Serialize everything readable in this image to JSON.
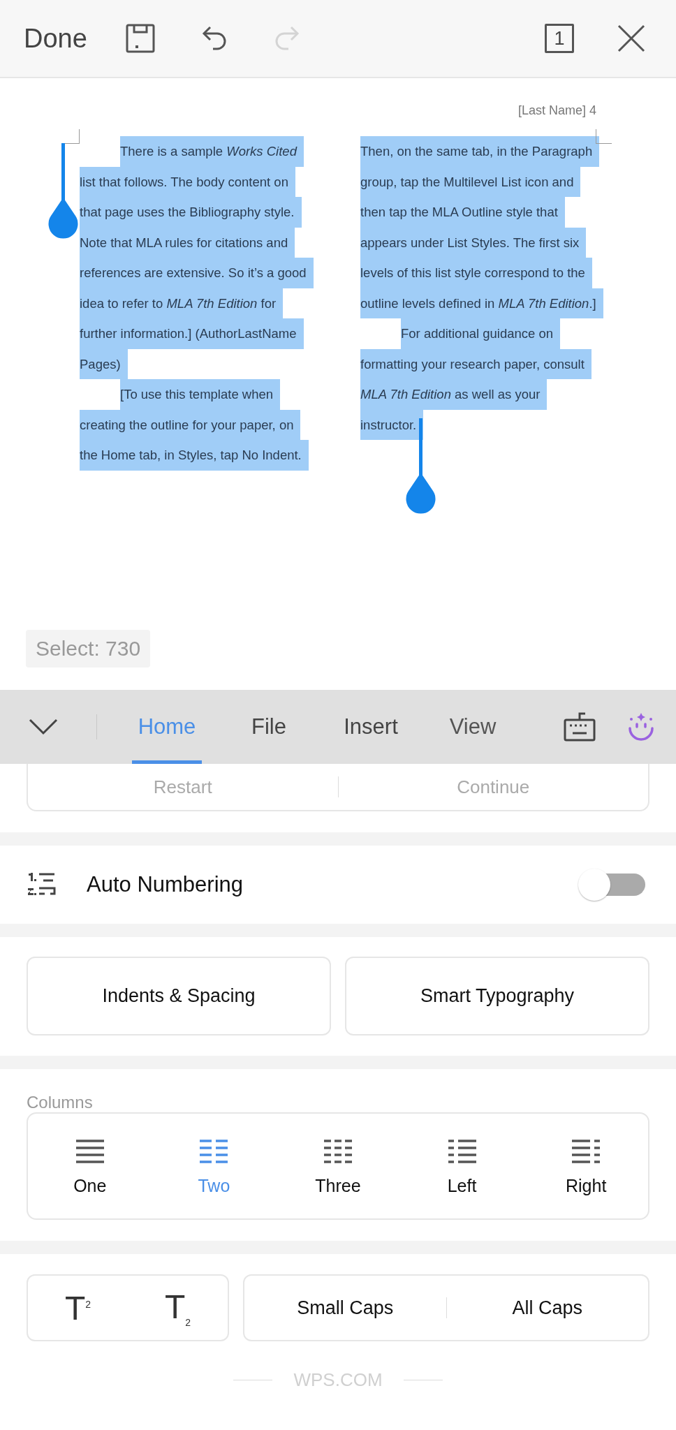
{
  "top_bar": {
    "done": "Done",
    "undo": {
      "disabled": false
    },
    "redo": {
      "disabled": true
    },
    "page_count": "1"
  },
  "document": {
    "header": "[Last Name] 4",
    "selected": true,
    "columns": [
      {
        "paragraphs": [
          {
            "indent": true,
            "lines": [
              "There is a sample *Works Cited*",
              "list that follows. The body content on",
              "that page uses the Bibliography style.",
              "Note that MLA rules for citations and",
              "references are extensive. So it’s a good",
              "idea to refer to *MLA 7th Edition* for",
              "further information.] (AuthorLastName",
              "Pages)"
            ]
          },
          {
            "indent": true,
            "lines": [
              "[To use this template when",
              "creating the outline for your paper, on",
              "the Home tab, in Styles, tap No Indent."
            ]
          }
        ]
      },
      {
        "paragraphs": [
          {
            "indent": false,
            "lines": [
              "Then, on the same tab, in the Paragraph",
              "group, tap the Multilevel List icon and",
              "then tap the MLA Outline style that",
              "appears under List Styles. The first six",
              "levels of this list style correspond to the",
              "outline levels defined in *MLA 7th Edition*.]"
            ]
          },
          {
            "indent": true,
            "lines": [
              "For additional guidance on",
              "formatting your research paper, consult",
              "*MLA 7th Edition* as well as your",
              "instructor."
            ]
          }
        ]
      }
    ]
  },
  "select_count": "Select: 730",
  "toolbar": {
    "tabs": [
      {
        "label": "Home",
        "selected": true
      },
      {
        "label": "File",
        "selected": false
      },
      {
        "label": "Insert",
        "selected": false
      },
      {
        "label": "View",
        "selected": false
      }
    ]
  },
  "numbering_buttons": [
    {
      "label": "Restart",
      "disabled": true
    },
    {
      "label": "Continue",
      "disabled": true
    }
  ],
  "auto_numbering": {
    "label": "Auto Numbering",
    "on": false
  },
  "paragraph_buttons": [
    "Indents & Spacing",
    "Smart Typography"
  ],
  "columns": {
    "label": "Columns",
    "options": [
      {
        "label": "One",
        "kind": "one",
        "selected": false
      },
      {
        "label": "Two",
        "kind": "two",
        "selected": true
      },
      {
        "label": "Three",
        "kind": "three",
        "selected": false
      },
      {
        "label": "Left",
        "kind": "left",
        "selected": false
      },
      {
        "label": "Right",
        "kind": "right",
        "selected": false
      }
    ]
  },
  "script_buttons": [
    "T$^{2}$",
    "T$_{2}$"
  ],
  "caps_buttons": [
    "Small Caps",
    "All Caps"
  ],
  "footer": "WPS.COM"
}
